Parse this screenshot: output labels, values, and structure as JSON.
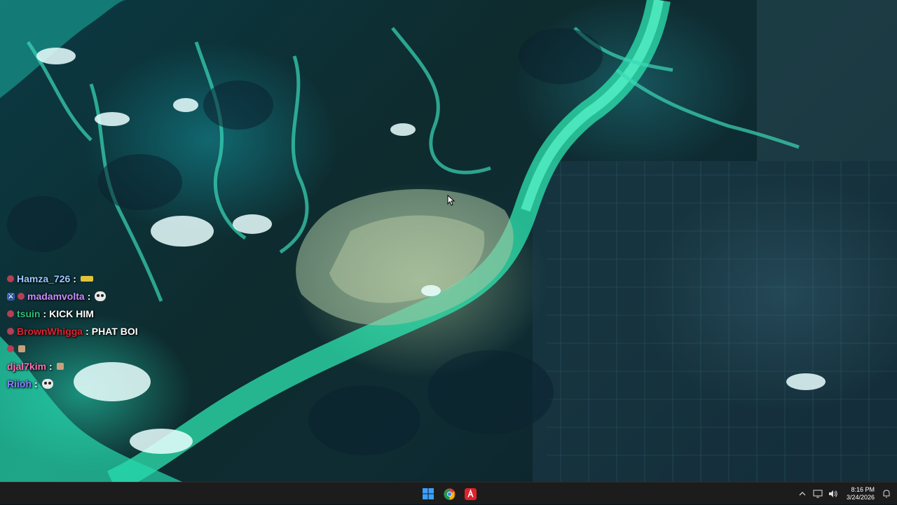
{
  "chat": {
    "messages": [
      {
        "user": "Hamza_726",
        "color": "#9cc8ff",
        "badges": [
          "sub"
        ],
        "text": "",
        "emote": "gold-car"
      },
      {
        "user": "madamvolta",
        "color": "#c98cff",
        "badges": [
          "mod",
          "sub"
        ],
        "text": "",
        "emote": "skull"
      },
      {
        "user": "tsuin",
        "color": "#2ec07a",
        "badges": [
          "sub"
        ],
        "text": "KICK HIM",
        "emote": ""
      },
      {
        "user": "BrownWhigga",
        "color": "#e0212f",
        "badges": [
          "sub"
        ],
        "text": "PHAT BOI",
        "emote": ""
      },
      {
        "user": "",
        "color": "#cccccc",
        "badges": [
          "sub"
        ],
        "text": "",
        "emote": "small"
      },
      {
        "user": "djal7kim",
        "color": "#ff6fb5",
        "badges": [],
        "text": "",
        "emote": "small"
      },
      {
        "user": "Riioh",
        "color": "#8a7dff",
        "badges": [],
        "text": "",
        "emote": "skull"
      }
    ]
  },
  "taskbar": {
    "apps": [
      {
        "name": "start",
        "icon": "windows-logo-icon"
      },
      {
        "name": "chrome",
        "icon": "chrome-icon"
      },
      {
        "name": "adobe",
        "icon": "adobe-acrobat-icon"
      }
    ],
    "tray_icons": [
      "chevron-up-icon",
      "network-icon",
      "volume-icon",
      "notification-icon"
    ],
    "time": "8:16 PM",
    "date": "3/24/2026"
  },
  "colors": {
    "taskbar_bg": "#1c1c1c",
    "windows_blue": "#3aa0ff",
    "adobe_red": "#e0222c"
  }
}
